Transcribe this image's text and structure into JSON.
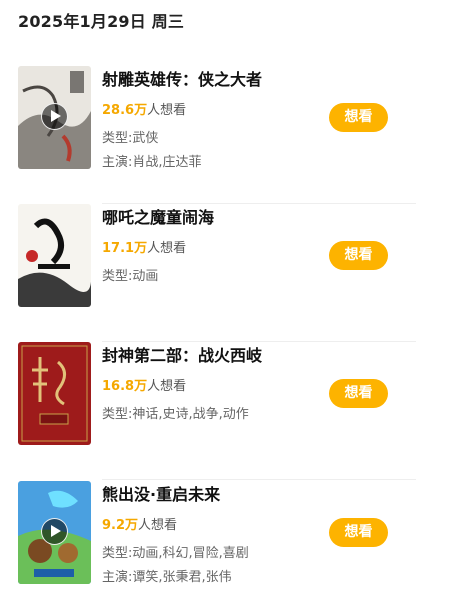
{
  "date_header": "2025年1月29日 周三",
  "movies": [
    {
      "title": "射雕英雄传：侠之大者",
      "want_count": "28.6万",
      "want_suffix": "人想看",
      "genre": "类型:武侠",
      "cast": "主演:肖战,庄达菲",
      "button": "想看",
      "has_trailer": true
    },
    {
      "title": "哪吒之魔童闹海",
      "want_count": "17.1万",
      "want_suffix": "人想看",
      "genre": "类型:动画",
      "cast": "",
      "button": "想看",
      "has_trailer": false
    },
    {
      "title": "封神第二部：战火西岐",
      "want_count": "16.8万",
      "want_suffix": "人想看",
      "genre": "类型:神话,史诗,战争,动作",
      "cast": "",
      "button": "想看",
      "has_trailer": false
    },
    {
      "title": "熊出没·重启未来",
      "want_count": "9.2万",
      "want_suffix": "人想看",
      "genre": "类型:动画,科幻,冒险,喜剧",
      "cast": "主演:谭笑,张秉君,张伟",
      "button": "想看",
      "has_trailer": true
    }
  ],
  "colors": {
    "accent": "#fdb300",
    "want_number": "#f5a800"
  }
}
